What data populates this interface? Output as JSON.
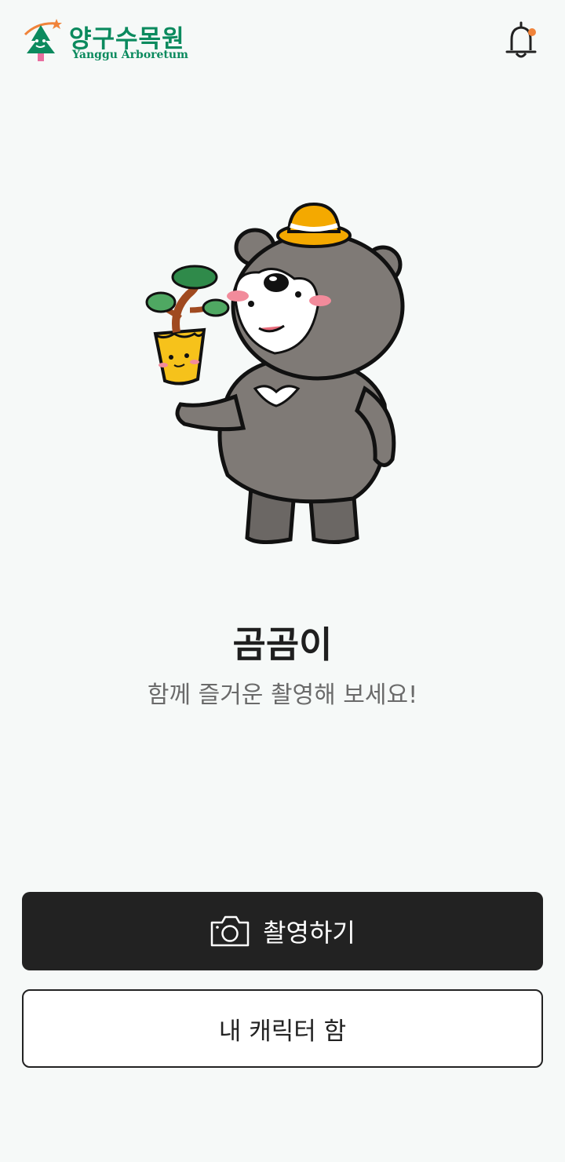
{
  "header": {
    "logo_kr": "양구수목원",
    "logo_en": "Yanggu Arboretum",
    "notification_icon": "bell-icon"
  },
  "character": {
    "name": "곰곰이",
    "subtitle": "함께 즐거운 촬영해 보세요!"
  },
  "actions": {
    "capture_label": "촬영하기",
    "capture_icon": "camera-icon",
    "my_box_label": "내 캐릭터 함"
  },
  "colors": {
    "brand_green": "#0b8a5e",
    "primary_button": "#222222",
    "notification_dot": "#f0833a",
    "background": "#f6f9f8"
  }
}
